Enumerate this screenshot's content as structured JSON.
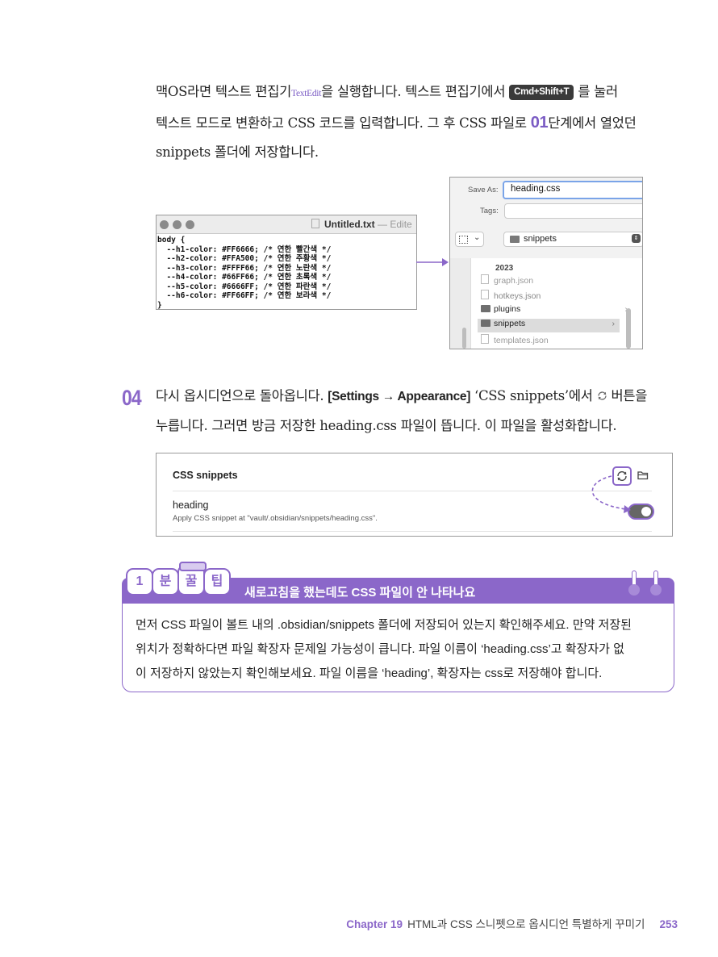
{
  "intro": {
    "line1_a": "맥OS라면 텍스트 편집기",
    "line1_textedit": "TextEdit",
    "line1_b": "을 실행합니다. 텍스트 편집기에서 ",
    "line1_shortcut": "Cmd+Shift+T",
    "line1_c": " 를 눌러",
    "line2_a": "텍스트 모드로 변환하고 CSS 코드를 입력합니다. 그 후 CSS 파일로 ",
    "line2_step": "01",
    "line2_b": "단계에서 열었던",
    "line3": "snippets 폴더에 저장합니다."
  },
  "editor": {
    "title": "Untitled.txt",
    "title_suffix": "— Edite",
    "code_lines": [
      "body {",
      "  --h1-color: #FF6666; /* 연한 빨간색 */",
      "  --h2-color: #FFA500; /* 연한 주황색 */",
      "  --h3-color: #FFFF66; /* 연한 노란색 */",
      "  --h4-color: #66FF66; /* 연한 초록색 */",
      "  --h5-color: #6666FF; /* 연한 파란색 */",
      "  --h6-color: #FF66FF; /* 연한 보라색 */",
      "}"
    ]
  },
  "save_dialog": {
    "save_as_label": "Save As:",
    "save_as_value": "heading.css",
    "tags_label": "Tags:",
    "location": "snippets",
    "group_label": "2023",
    "items": [
      {
        "name": "graph.json",
        "type": "file"
      },
      {
        "name": "hotkeys.json",
        "type": "file"
      },
      {
        "name": "plugins",
        "type": "folder"
      },
      {
        "name": "snippets",
        "type": "folder"
      },
      {
        "name": "templates.json",
        "type": "file"
      }
    ]
  },
  "step04": {
    "number": "04",
    "line1_a": "다시 옵시디언으로 돌아옵니다. ",
    "line1_bold": "[Settings → Appearance]",
    "line1_b": " ‘CSS snippets’에서 ",
    "line1_c": " 버튼을",
    "line2": "누릅니다. 그러면 방금 저장한 heading.css 파일이 뜹니다. 이 파일을 활성화합니다."
  },
  "settings_panel": {
    "section_title": "CSS snippets",
    "snippet_name": "heading",
    "snippet_desc": "Apply CSS snippet at \"vault/.obsidian/snippets/heading.css\".",
    "toggle_on": true,
    "accent_color": "#8b67c9"
  },
  "tip": {
    "badge": [
      "1",
      "분",
      "꿀",
      "팁"
    ],
    "title": "새로고침을 했는데도 CSS 파일이 안 나타나요",
    "lines": [
      "먼저 CSS 파일이 볼트 내의 .obsidian/snippets 폴더에 저장되어 있는지 확인해주세요. 만약 저장된",
      "위치가 정확하다면 파일 확장자 문제일 가능성이 큽니다.  파일 이름이 ‘heading.css’고 확장자가 없",
      "이 저장하지 않았는지 확인해보세요. 파일 이름을 ‘heading’, 확장자는 css로 저장해야 합니다."
    ],
    "color": "#8b67c9"
  },
  "footer": {
    "chapter": "Chapter 19",
    "title": "HTML과 CSS 스니펫으로 옵시디언 특별하게 꾸미기",
    "page": "253"
  }
}
